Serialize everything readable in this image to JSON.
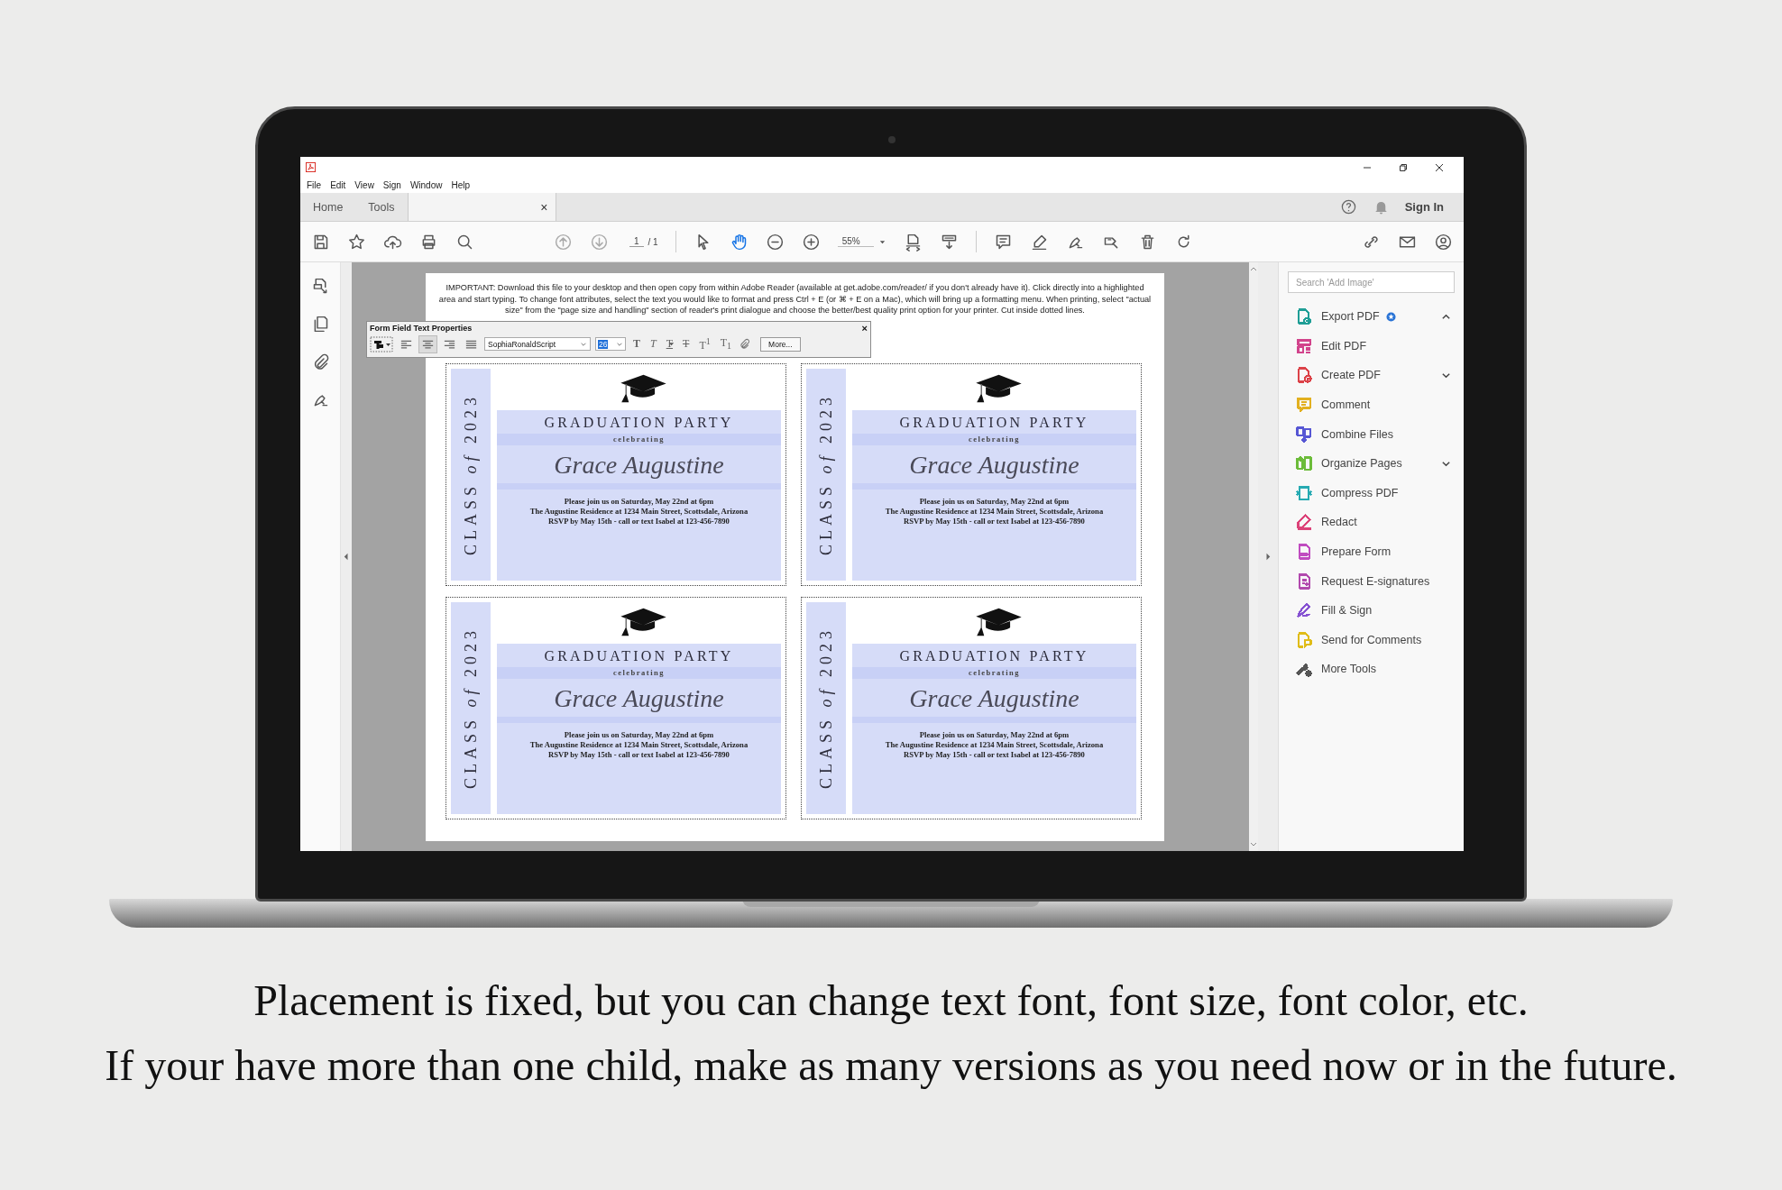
{
  "window": {
    "menu": [
      "File",
      "Edit",
      "View",
      "Sign",
      "Window",
      "Help"
    ]
  },
  "tabs": [
    {
      "label": "Home",
      "selected": false
    },
    {
      "label": "Tools",
      "selected": false
    }
  ],
  "document_tab": {
    "close": "×",
    "selected": true
  },
  "account": {
    "sign_in": "Sign In"
  },
  "toolbar": {
    "page": "1",
    "page_total": "/ 1",
    "zoom": "55%",
    "tools": [
      {
        "kind": "pointer",
        "selected": false
      },
      {
        "kind": "hand",
        "selected": true
      }
    ]
  },
  "document": {
    "notice": "IMPORTANT: Download this file to your desktop and then open copy from within Adobe Reader (available at get.adobe.com/reader/ if you don't already have it). Click directly into a highlighted area and start typing. To change font attributes, select the text you would like to format and press Ctrl + E (or ⌘ + E on a Mac), which will bring up a formatting menu. When printing, select \"actual size\" from the \"page size and handling\" section of reader's print dialogue and choose the better/best quality print option for your printer. Cut inside dotted lines.",
    "cards": [
      {
        "class_label": "CLASS *of* 2023",
        "title": "GRADUATION PARTY",
        "subtitle": "celebrating",
        "name": "Grace Augustine",
        "details": [
          "Please join us on Saturday, May 22nd at 6pm",
          "The Augustine Residence at 1234 Main Street, Scottsdale, Arizona",
          "RSVP by May 15th - call or text Isabel at 123-456-7890"
        ]
      },
      {
        "class_label": "CLASS *of* 2023",
        "title": "GRADUATION PARTY",
        "subtitle": "celebrating",
        "name": "Grace Augustine",
        "details": [
          "Please join us on Saturday, May 22nd at 6pm",
          "The Augustine Residence at 1234 Main Street, Scottsdale, Arizona",
          "RSVP by May 15th - call or text Isabel at 123-456-7890"
        ]
      },
      {
        "class_label": "CLASS *of* 2023",
        "title": "GRADUATION PARTY",
        "subtitle": "celebrating",
        "name": "Grace Augustine",
        "details": [
          "Please join us on Saturday, May 22nd at 6pm",
          "The Augustine Residence at 1234 Main Street, Scottsdale, Arizona",
          "RSVP by May 15th - call or text Isabel at 123-456-7890"
        ]
      },
      {
        "class_label": "CLASS *of* 2023",
        "title": "GRADUATION PARTY",
        "subtitle": "celebrating",
        "name": "Grace Augustine",
        "details": [
          "Please join us on Saturday, May 22nd at 6pm",
          "The Augustine Residence at 1234 Main Street, Scottsdale, Arizona",
          "RSVP by May 15th - call or text Isabel at 123-456-7890"
        ]
      }
    ]
  },
  "text_properties": {
    "title": "Form Field Text Properties",
    "close": "×",
    "align": [
      {
        "kind": "left",
        "selected": false
      },
      {
        "kind": "center",
        "selected": true
      },
      {
        "kind": "right",
        "selected": false
      },
      {
        "kind": "justify",
        "selected": false
      }
    ],
    "font": "SophiaRonaldScript",
    "size": "26",
    "size_highlighted": true,
    "styles": [
      {
        "kind": "bold",
        "glyph": "T"
      },
      {
        "kind": "italic",
        "glyph": "T"
      },
      {
        "kind": "underline",
        "glyph": "T"
      },
      {
        "kind": "strike",
        "glyph": "T"
      },
      {
        "kind": "superscript",
        "glyph": "T$^{1}$"
      },
      {
        "kind": "subscript",
        "glyph": "T$_{1}$"
      }
    ],
    "more": "More..."
  },
  "tools_panel": {
    "search_placeholder": "Search 'Add Image'",
    "items": [
      {
        "label": "Export PDF",
        "kind": "group",
        "expanded": true,
        "badge": true,
        "color": "#1f9e96"
      },
      {
        "label": "Edit PDF",
        "kind": "tool",
        "badge": false,
        "color": "#d2448c"
      },
      {
        "label": "Create PDF",
        "kind": "group",
        "expanded": false,
        "badge": false,
        "color": "#dc4349"
      },
      {
        "label": "Comment",
        "kind": "tool",
        "badge": false,
        "color": "#e2b020"
      },
      {
        "label": "Combine Files",
        "kind": "tool",
        "badge": false,
        "color": "#5757d4"
      },
      {
        "label": "Organize Pages",
        "kind": "group",
        "expanded": false,
        "badge": false,
        "color": "#6cbc3a"
      },
      {
        "label": "Compress PDF",
        "kind": "tool",
        "badge": false,
        "color": "#26aab2"
      },
      {
        "label": "Redact",
        "kind": "tool",
        "badge": false,
        "color": "#dc4379"
      },
      {
        "label": "Prepare Form",
        "kind": "tool",
        "badge": false,
        "color": "#c04cc0"
      },
      {
        "label": "Request E-signatures",
        "kind": "tool",
        "badge": false,
        "color": "#b24aae"
      },
      {
        "label": "Fill & Sign",
        "kind": "tool",
        "badge": false,
        "color": "#8652d2"
      },
      {
        "label": "Send for Comments",
        "kind": "tool",
        "badge": false,
        "color": "#e0bc18"
      },
      {
        "label": "More Tools",
        "kind": "tool",
        "badge": false,
        "color": "#555555"
      }
    ]
  },
  "caption": [
    "Placement is fixed, but you can change text font, font size, font color, etc.",
    "If your have more than one child, make as many versions as you need now or in the future."
  ]
}
